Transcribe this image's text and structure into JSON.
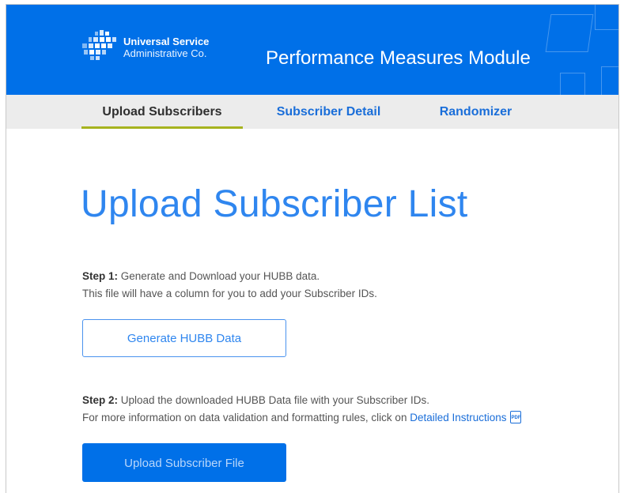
{
  "header": {
    "org_line1": "Universal Service",
    "org_line2": "Administrative Co.",
    "module_title": "Performance Measures Module",
    "logo_icon": "usac-logo-icon",
    "background_color": "#0070e8"
  },
  "nav": {
    "tabs": [
      {
        "label": "Upload Subscribers",
        "active": true
      },
      {
        "label": "Subscriber Detail",
        "active": false
      },
      {
        "label": "Randomizer",
        "active": false
      }
    ],
    "active_underline_color": "#a6b31f"
  },
  "main": {
    "title": "Upload Subscriber List",
    "step1": {
      "label": "Step 1:",
      "text": " Generate and Download your HUBB data.",
      "subtext": "This file will have a column for you to add your Subscriber IDs."
    },
    "generate_button": "Generate HUBB Data",
    "step2": {
      "label": "Step 2:",
      "text": " Upload the downloaded HUBB Data file with your Subscriber IDs.",
      "subtext": "For more information on data validation and formatting rules, click on ",
      "link": "Detailed Instructions",
      "link_icon": "pdf-icon"
    },
    "upload_button": "Upload Subscriber File"
  }
}
